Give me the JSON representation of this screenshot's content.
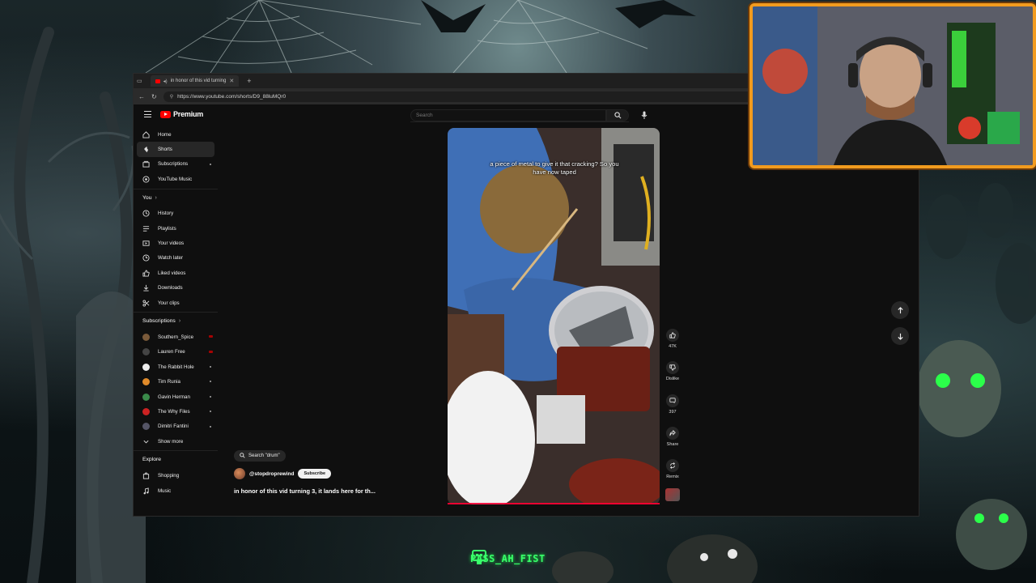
{
  "browser": {
    "tab_title": "in honor of this vid turning",
    "url": "https://www.youtube.com/shorts/D9_88luMQr0",
    "new_tab_symbol": "+"
  },
  "header": {
    "logo_text": "Premium",
    "search_placeholder": "Search"
  },
  "sidebar": {
    "primary": [
      {
        "label": "Home",
        "icon": "home-icon"
      },
      {
        "label": "Shorts",
        "icon": "shorts-icon",
        "active": true
      },
      {
        "label": "Subscriptions",
        "icon": "subscriptions-icon"
      },
      {
        "label": "YouTube Music",
        "icon": "music-icon"
      }
    ],
    "you_header": "You",
    "you_items": [
      {
        "label": "History",
        "icon": "history-icon"
      },
      {
        "label": "Playlists",
        "icon": "playlists-icon"
      },
      {
        "label": "Your videos",
        "icon": "video-icon"
      },
      {
        "label": "Watch later",
        "icon": "clock-icon"
      },
      {
        "label": "Liked videos",
        "icon": "like-icon"
      },
      {
        "label": "Downloads",
        "icon": "download-icon"
      },
      {
        "label": "Your clips",
        "icon": "scissors-icon"
      }
    ],
    "subs_header": "Subscriptions",
    "subscriptions": [
      {
        "label": "Southern_Spice",
        "color": "#7a5a3a"
      },
      {
        "label": "Lauren Free",
        "color": "#444444"
      },
      {
        "label": "The Rabbit Hole",
        "color": "#eeeeee"
      },
      {
        "label": "Tim Runia",
        "color": "#e08a2a"
      },
      {
        "label": "Gavin Herman",
        "color": "#3a8a4a"
      },
      {
        "label": "The Why Files",
        "color": "#cc2222"
      },
      {
        "label": "Dimitri Fantini",
        "color": "#555566"
      }
    ],
    "show_more": "Show more",
    "explore_header": "Explore",
    "explore": [
      {
        "label": "Shopping",
        "icon": "bag-icon"
      },
      {
        "label": "Music",
        "icon": "music-note-icon"
      }
    ]
  },
  "short": {
    "caption": "a piece of metal to give it that cracking? So you have now taped",
    "search_chip": "Search \"drum\"",
    "channel": "@stopdroprewind",
    "subscribe": "Subscribe",
    "title": "in honor of this vid turning 3, it lands here for th..."
  },
  "actions": {
    "likes": "47K",
    "dislike": "Dislike",
    "comments": "397",
    "share": "Share",
    "remix": "Remix"
  },
  "overlay": {
    "streamer_tag": "PASS_AH_FIST",
    "accent_color": "#39ff6a",
    "webcam_frame_color": "#f29b1e"
  }
}
